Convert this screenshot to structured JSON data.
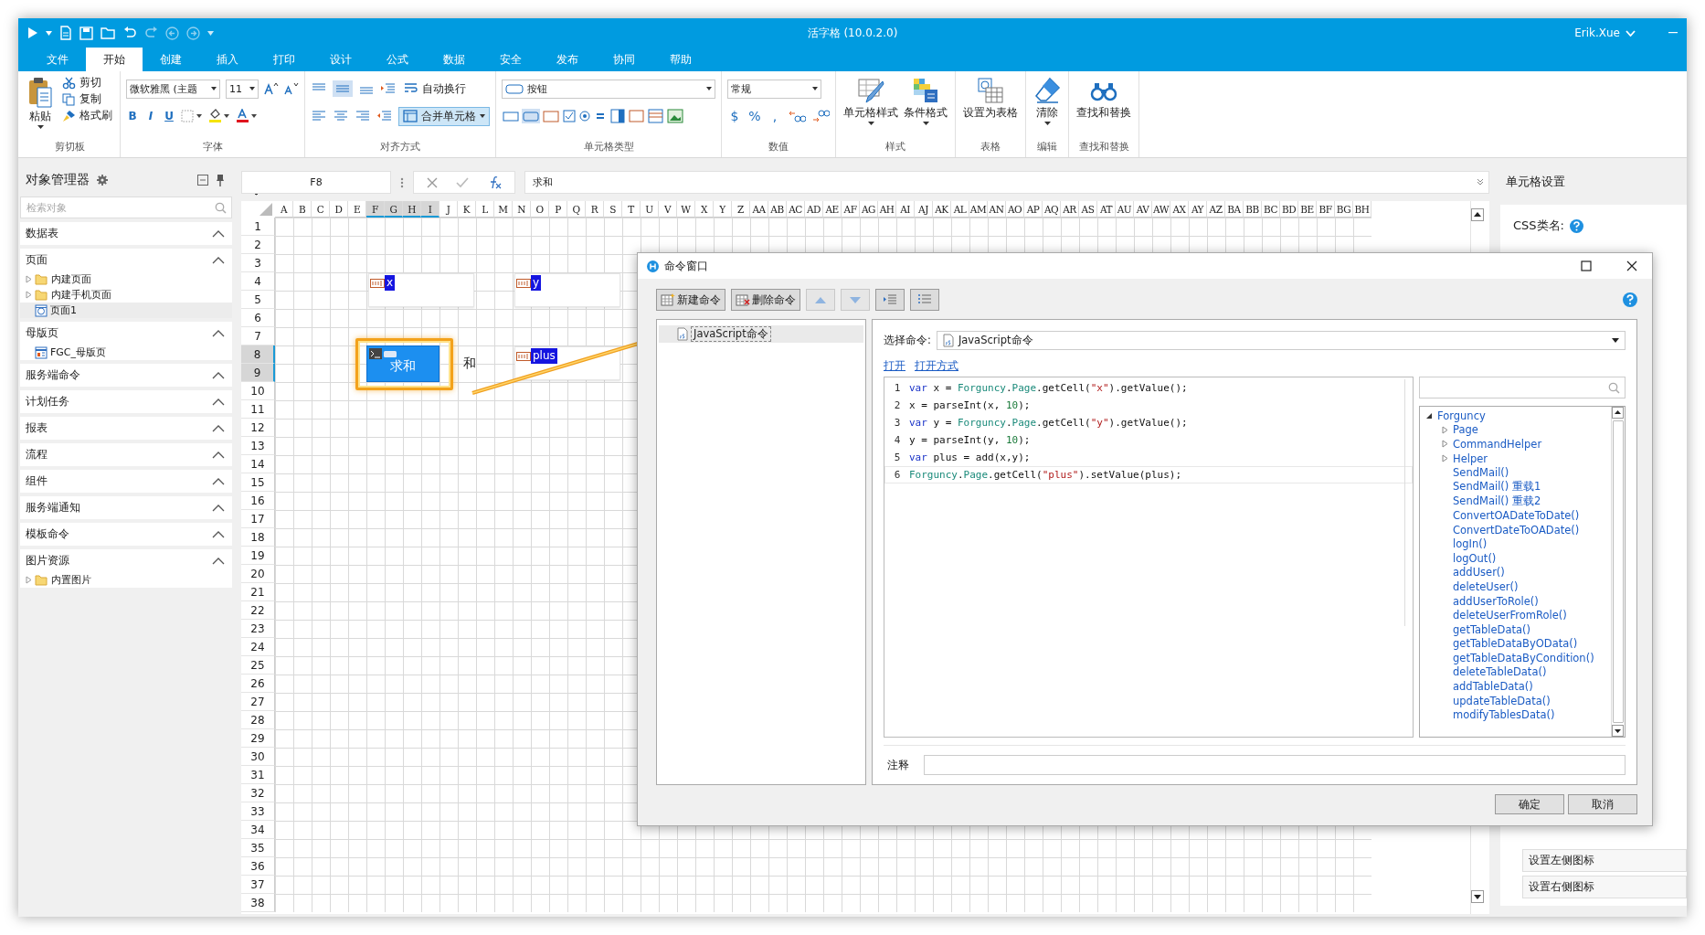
{
  "window": {
    "title": "活字格 (10.0.2.0)",
    "user": "Erik.Xue"
  },
  "tabs": [
    {
      "label": "文件",
      "selected": false
    },
    {
      "label": "开始",
      "selected": true
    },
    {
      "label": "创建",
      "selected": false
    },
    {
      "label": "插入",
      "selected": false
    },
    {
      "label": "打印",
      "selected": false
    },
    {
      "label": "设计",
      "selected": false
    },
    {
      "label": "公式",
      "selected": false
    },
    {
      "label": "数据",
      "selected": false
    },
    {
      "label": "安全",
      "selected": false
    },
    {
      "label": "发布",
      "selected": false
    },
    {
      "label": "协同",
      "selected": false
    },
    {
      "label": "帮助",
      "selected": false
    }
  ],
  "ribbon": [
    {
      "kind": "clipboard",
      "label": "剪切板",
      "paste": "粘贴",
      "items": [
        "剪切",
        "复制",
        "格式刷"
      ]
    },
    {
      "kind": "font",
      "label": "字体",
      "font_name": "微软雅黑 (主题",
      "size": "11",
      "styles": [
        "B",
        "I",
        "U"
      ]
    },
    {
      "kind": "align",
      "label": "对齐方式",
      "wrap": "自动换行",
      "merge": "合并单元格",
      "merge_on": true
    },
    {
      "kind": "celltype",
      "label": "单元格类型",
      "type": "按钮"
    },
    {
      "kind": "number",
      "label": "数值",
      "format": "常规",
      "symbols": [
        "$",
        "%",
        ","
      ]
    },
    {
      "kind": "styles",
      "label": "样式",
      "buttons": [
        "单元格样式",
        "条件格式"
      ]
    },
    {
      "kind": "table",
      "label": "表格",
      "buttons": [
        "设置为表格"
      ]
    },
    {
      "kind": "edit",
      "label": "编辑",
      "buttons": [
        "清除"
      ]
    },
    {
      "kind": "find",
      "label": "查找和替换",
      "buttons": [
        "查找和替换"
      ]
    }
  ],
  "object_manager": {
    "title": "对象管理器",
    "search": {
      "placeholder": "检索对象"
    },
    "sections": [
      {
        "label": "数据表",
        "expanded": true
      },
      {
        "label": "页面",
        "expanded": true,
        "children": [
          {
            "label": "内建页面",
            "kind": "folder",
            "expanded": false,
            "selected": false
          },
          {
            "label": "内建手机页面",
            "kind": "folder",
            "expanded": false,
            "selected": false
          },
          {
            "label": "页面1",
            "kind": "page",
            "selected": true
          }
        ]
      },
      {
        "label": "母版页",
        "expanded": true,
        "children": [
          {
            "label": "FGC_母版页",
            "kind": "master",
            "selected": false
          }
        ]
      },
      {
        "label": "服务端命令",
        "expanded": true
      },
      {
        "label": "计划任务",
        "expanded": true
      },
      {
        "label": "报表",
        "expanded": true
      },
      {
        "label": "流程",
        "expanded": true
      },
      {
        "label": "组件",
        "expanded": true
      },
      {
        "label": "服务端通知",
        "expanded": true
      },
      {
        "label": "模板命令",
        "expanded": true
      },
      {
        "label": "图片资源",
        "expanded": true,
        "children": [
          {
            "label": "内置图片",
            "kind": "folder",
            "expanded": false,
            "selected": false
          }
        ]
      }
    ]
  },
  "formula_bar": {
    "cell": "F8",
    "value": "求和"
  },
  "sheet": {
    "columns": [
      {
        "label": "A",
        "selected": false
      },
      {
        "label": "B",
        "selected": false
      },
      {
        "label": "C",
        "selected": false
      },
      {
        "label": "D",
        "selected": false
      },
      {
        "label": "E",
        "selected": false
      },
      {
        "label": "F",
        "selected": true
      },
      {
        "label": "G",
        "selected": true
      },
      {
        "label": "H",
        "selected": true
      },
      {
        "label": "I",
        "selected": true
      },
      {
        "label": "J",
        "selected": false
      },
      {
        "label": "K",
        "selected": false
      },
      {
        "label": "L",
        "selected": false
      },
      {
        "label": "M",
        "selected": false
      },
      {
        "label": "N",
        "selected": false
      },
      {
        "label": "O",
        "selected": false
      },
      {
        "label": "P",
        "selected": false
      },
      {
        "label": "Q",
        "selected": false
      },
      {
        "label": "R",
        "selected": false
      },
      {
        "label": "S",
        "selected": false
      },
      {
        "label": "T",
        "selected": false
      },
      {
        "label": "U",
        "selected": false
      },
      {
        "label": "V",
        "selected": false
      },
      {
        "label": "W",
        "selected": false
      },
      {
        "label": "X",
        "selected": false
      },
      {
        "label": "Y",
        "selected": false
      },
      {
        "label": "Z",
        "selected": false
      },
      {
        "label": "AA",
        "selected": false
      },
      {
        "label": "AB",
        "selected": false
      },
      {
        "label": "AC",
        "selected": false
      },
      {
        "label": "AD",
        "selected": false
      },
      {
        "label": "AE",
        "selected": false
      },
      {
        "label": "AF",
        "selected": false
      },
      {
        "label": "AG",
        "selected": false
      },
      {
        "label": "AH",
        "selected": false
      },
      {
        "label": "AI",
        "selected": false
      },
      {
        "label": "AJ",
        "selected": false
      },
      {
        "label": "AK",
        "selected": false
      },
      {
        "label": "AL",
        "selected": false
      },
      {
        "label": "AM",
        "selected": false
      },
      {
        "label": "AN",
        "selected": false
      },
      {
        "label": "AO",
        "selected": false
      },
      {
        "label": "AP",
        "selected": false
      },
      {
        "label": "AQ",
        "selected": false
      },
      {
        "label": "AR",
        "selected": false
      },
      {
        "label": "AS",
        "selected": false
      },
      {
        "label": "AT",
        "selected": false
      },
      {
        "label": "AU",
        "selected": false
      },
      {
        "label": "AV",
        "selected": false
      },
      {
        "label": "AW",
        "selected": false
      },
      {
        "label": "AX",
        "selected": false
      },
      {
        "label": "AY",
        "selected": false
      },
      {
        "label": "AZ",
        "selected": false
      },
      {
        "label": "BA",
        "selected": false
      },
      {
        "label": "BB",
        "selected": false
      },
      {
        "label": "BC",
        "selected": false
      },
      {
        "label": "BD",
        "selected": false
      },
      {
        "label": "BE",
        "selected": false
      },
      {
        "label": "BF",
        "selected": false
      },
      {
        "label": "BG",
        "selected": false
      },
      {
        "label": "BH",
        "selected": false
      }
    ],
    "rows": [
      {
        "label": "1",
        "selected": false
      },
      {
        "label": "2",
        "selected": false
      },
      {
        "label": "3",
        "selected": false
      },
      {
        "label": "4",
        "selected": false
      },
      {
        "label": "5",
        "selected": false
      },
      {
        "label": "6",
        "selected": false
      },
      {
        "label": "7",
        "selected": false
      },
      {
        "label": "8",
        "selected": true
      },
      {
        "label": "9",
        "selected": true
      },
      {
        "label": "10",
        "selected": false
      },
      {
        "label": "11",
        "selected": false
      },
      {
        "label": "12",
        "selected": false
      },
      {
        "label": "13",
        "selected": false
      },
      {
        "label": "14",
        "selected": false
      },
      {
        "label": "15",
        "selected": false
      },
      {
        "label": "16",
        "selected": false
      },
      {
        "label": "17",
        "selected": false
      },
      {
        "label": "18",
        "selected": false
      },
      {
        "label": "19",
        "selected": false
      },
      {
        "label": "20",
        "selected": false
      },
      {
        "label": "21",
        "selected": false
      },
      {
        "label": "22",
        "selected": false
      },
      {
        "label": "23",
        "selected": false
      },
      {
        "label": "24",
        "selected": false
      },
      {
        "label": "25",
        "selected": false
      },
      {
        "label": "26",
        "selected": false
      },
      {
        "label": "27",
        "selected": false
      },
      {
        "label": "28",
        "selected": false
      },
      {
        "label": "29",
        "selected": false
      },
      {
        "label": "30",
        "selected": false
      },
      {
        "label": "31",
        "selected": false
      },
      {
        "label": "32",
        "selected": false
      },
      {
        "label": "33",
        "selected": false
      },
      {
        "label": "34",
        "selected": false
      },
      {
        "label": "35",
        "selected": false
      },
      {
        "label": "36",
        "selected": false
      },
      {
        "label": "37",
        "selected": false
      },
      {
        "label": "38",
        "selected": false
      }
    ],
    "widgets": [
      {
        "kind": "textbox",
        "name": "x"
      },
      {
        "kind": "textbox",
        "name": "y"
      },
      {
        "kind": "button",
        "text": "求和",
        "highlighted": true
      },
      {
        "kind": "label",
        "text": "和"
      },
      {
        "kind": "textbox",
        "name": "plus"
      }
    ]
  },
  "cell_settings": {
    "title": "单元格设置",
    "css_label": "CSS类名:",
    "buttons": [
      "设置左侧图标",
      "设置右侧图标"
    ]
  },
  "dialog": {
    "title": "命令窗口",
    "toolbar": [
      "新建命令",
      "删除命令"
    ],
    "commands": [
      {
        "label": "JavaScript命令",
        "selected": true
      }
    ],
    "select_label": "选择命令:",
    "command_type": "JavaScript命令",
    "links": [
      "打开",
      "打开方式"
    ],
    "code": [
      {
        "no": "1",
        "current": false,
        "tokens": [
          {
            "t": "var",
            "kind": "kw"
          },
          {
            "t": " x = ",
            "kind": "txt"
          },
          {
            "t": "Forguncy",
            "kind": "obj"
          },
          {
            "t": ".",
            "kind": "txt"
          },
          {
            "t": "Page",
            "kind": "obj"
          },
          {
            "t": ".getCell(",
            "kind": "txt"
          },
          {
            "t": "\"x\"",
            "kind": "str"
          },
          {
            "t": ").getValue();",
            "kind": "txt"
          }
        ]
      },
      {
        "no": "2",
        "current": false,
        "tokens": [
          {
            "t": "x = parseInt(x, ",
            "kind": "txt"
          },
          {
            "t": "10",
            "kind": "num"
          },
          {
            "t": ");",
            "kind": "txt"
          }
        ]
      },
      {
        "no": "3",
        "current": false,
        "tokens": [
          {
            "t": "var",
            "kind": "kw"
          },
          {
            "t": " y = ",
            "kind": "txt"
          },
          {
            "t": "Forguncy",
            "kind": "obj"
          },
          {
            "t": ".",
            "kind": "txt"
          },
          {
            "t": "Page",
            "kind": "obj"
          },
          {
            "t": ".getCell(",
            "kind": "txt"
          },
          {
            "t": "\"y\"",
            "kind": "str"
          },
          {
            "t": ").getValue();",
            "kind": "txt"
          }
        ]
      },
      {
        "no": "4",
        "current": false,
        "tokens": [
          {
            "t": "y = parseInt(y, ",
            "kind": "txt"
          },
          {
            "t": "10",
            "kind": "num"
          },
          {
            "t": ");",
            "kind": "txt"
          }
        ]
      },
      {
        "no": "5",
        "current": false,
        "tokens": [
          {
            "t": "var",
            "kind": "kw"
          },
          {
            "t": " plus = add(x,y);",
            "kind": "txt"
          }
        ]
      },
      {
        "no": "6",
        "current": true,
        "tokens": [
          {
            "t": "Forguncy",
            "kind": "obj"
          },
          {
            "t": ".",
            "kind": "txt"
          },
          {
            "t": "Page",
            "kind": "obj"
          },
          {
            "t": ".getCell(",
            "kind": "txt"
          },
          {
            "t": "\"plus\"",
            "kind": "str"
          },
          {
            "t": ").setValue(plus);",
            "kind": "txt"
          }
        ]
      }
    ],
    "api_tree": {
      "label": "Forguncy",
      "expanded": true,
      "children": [
        {
          "label": "Page",
          "expanded": false
        },
        {
          "label": "CommandHelper",
          "expanded": false
        },
        {
          "label": "Helper",
          "expanded": false
        },
        {
          "label": "SendMail()"
        },
        {
          "label": "SendMail() 重载1"
        },
        {
          "label": "SendMail() 重载2"
        },
        {
          "label": "ConvertOADateToDate()"
        },
        {
          "label": "ConvertDateToOADate()"
        },
        {
          "label": "logIn()"
        },
        {
          "label": "logOut()"
        },
        {
          "label": "addUser()"
        },
        {
          "label": "deleteUser()"
        },
        {
          "label": "addUserToRole()"
        },
        {
          "label": "deleteUserFromRole()"
        },
        {
          "label": "getTableData()"
        },
        {
          "label": "getTableDataByOData()"
        },
        {
          "label": "getTableDataByCondition()"
        },
        {
          "label": "deleteTableData()"
        },
        {
          "label": "addTableData()"
        },
        {
          "label": "updateTableData()"
        },
        {
          "label": "modifyTablesData()"
        }
      ]
    },
    "note_label": "注释",
    "buttons": [
      "确定",
      "取消"
    ]
  }
}
